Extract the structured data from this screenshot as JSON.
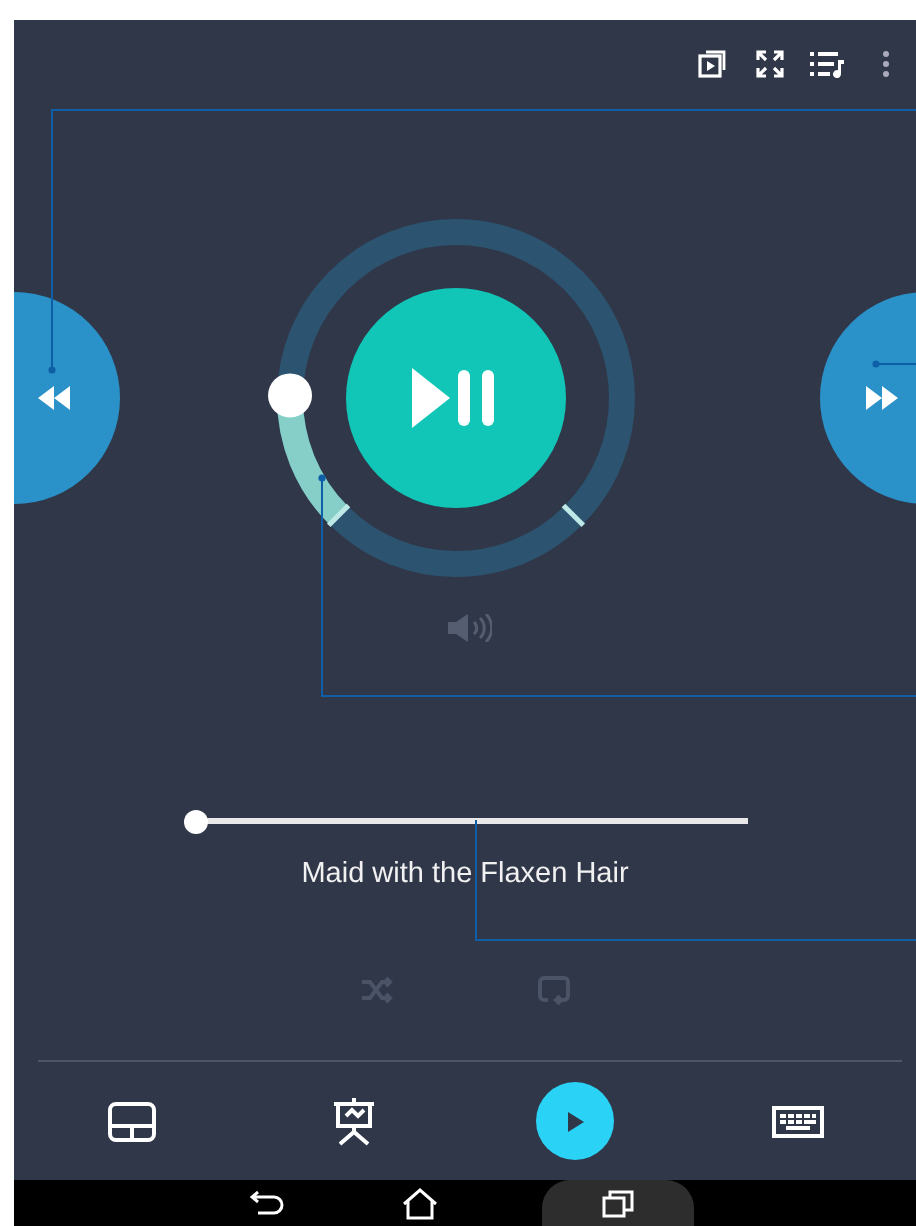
{
  "top_bar": {
    "icons": [
      {
        "kind": "cast"
      },
      {
        "kind": "fullscreen"
      },
      {
        "kind": "playlist"
      },
      {
        "kind": "more"
      }
    ]
  },
  "knob": {
    "level": 0.17
  },
  "track": {
    "title": "Maid with the Flaxen Hair",
    "progress": {
      "level": 0
    }
  },
  "modes": {
    "shuffle": {
      "on": false
    },
    "repeat": {
      "on": false
    }
  },
  "bottom_tabs": [
    {
      "kind": "touchpad",
      "selected": false
    },
    {
      "kind": "presentation",
      "selected": false
    },
    {
      "kind": "media",
      "selected": true
    },
    {
      "kind": "keyboard",
      "selected": false
    }
  ]
}
